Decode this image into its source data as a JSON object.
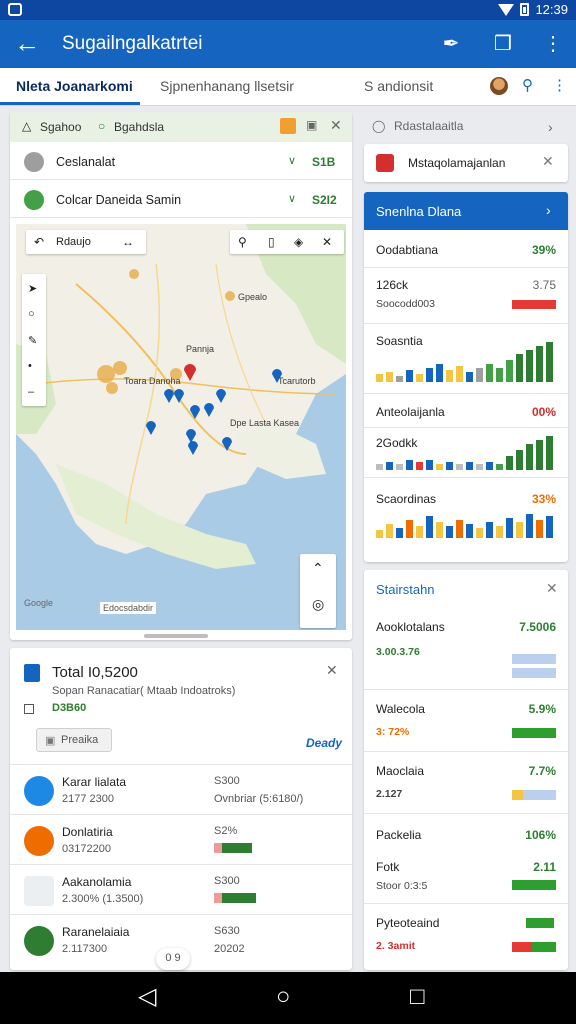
{
  "status_bar": {
    "time": "12:39"
  },
  "app_bar": {
    "title": "Sugailngalkatrtei"
  },
  "tabs": [
    {
      "label": "Nleta Joanarkomi"
    },
    {
      "label": "Sjpnenhanang llsetsir"
    },
    {
      "label": "S andionsit"
    }
  ],
  "map_panel": {
    "header_left": "Sgahoo",
    "header_mid": "Bgahdsla",
    "rows": [
      {
        "name": "Ceslanalat",
        "value": "S1B",
        "color": "#9e9e9e"
      },
      {
        "name": "Colcar Daneida Samin",
        "value": "S2I2",
        "color": "#43a047"
      }
    ],
    "toolbar_label": "Rdaujo",
    "labels": {
      "city1": "Gpealo",
      "city2": "Pannja",
      "city3": "Toara Danoha",
      "city4": "Tcarutorb",
      "city5": "Dpe Lasta Kasea"
    },
    "credit": "Google",
    "scale": "Edocsdabdir"
  },
  "total_panel": {
    "title": "Total I0,5200",
    "subtitle": "Sopan Ranacatiar( Mtaab Indoatroks)",
    "number": "D3B60",
    "button": "Preaika",
    "link": "Deady",
    "items": [
      {
        "name": "Karar lialata",
        "sub": "2177 2300",
        "val": "S300",
        "val2": "Ovnbriar (5:6180/)",
        "color": "#1e88e5"
      },
      {
        "name": "Donlatiria",
        "sub": "03172200",
        "val": "S2%",
        "color": "#ef6c00"
      },
      {
        "name": "Aakanolamia",
        "sub": "2.300% (1.3500)",
        "val": "S300",
        "color": "#eceff1"
      },
      {
        "name": "Raranelaiaia",
        "sub": "2.117300",
        "val": "S630",
        "val2": "20202",
        "color": "#2e7d32"
      }
    ],
    "pill": "0 9"
  },
  "right": {
    "strip_title": "Rdastalaaitla",
    "notif": "Mstaqolamajanlan",
    "stats_title": "Snenlna Dlana",
    "rows": [
      {
        "label": "Oodabtiana",
        "pct": "39%",
        "pct_color": "#2e7d32"
      },
      {
        "label": "126ck",
        "sub": "Soocodd003",
        "pct": "3.75",
        "pct_color": "#666"
      },
      {
        "label": "Soasntia"
      },
      {
        "label": "Anteolaijanla",
        "pct": "00%",
        "pct_color": "#d32f2f"
      },
      {
        "label": "2Godkk"
      },
      {
        "label": "Scaordinas",
        "pct": "33%",
        "pct_color": "#ef6c00"
      }
    ],
    "stat2_title": "Stairstahn",
    "stat2_rows": [
      {
        "label": "Aooklotalans",
        "pct": "7.5006",
        "sub": "3.00.3.76",
        "pct_color": "#2e7d32",
        "sub_color": "#2e7d32"
      },
      {
        "label": "Walecola",
        "pct": "5.9%",
        "sub": "3: 72%",
        "pct_color": "#2e7d32",
        "sub_color": "#ef6c00"
      },
      {
        "label": "Maoclaia",
        "pct": "7.7%",
        "sub": "2.127",
        "pct_color": "#2e7d32",
        "sub_color": "#444"
      },
      {
        "label": "Packelia",
        "pct": "106%",
        "pct_color": "#2e7d32"
      },
      {
        "label": "Fotk",
        "pct": "2.11",
        "sub": "Stoor 0:3:5",
        "pct_color": "#2e7d32",
        "sub_color": "#444"
      },
      {
        "label": "Pyteoteaind",
        "sub": "2. 3amit",
        "sub_color": "#d32f2f"
      }
    ]
  }
}
